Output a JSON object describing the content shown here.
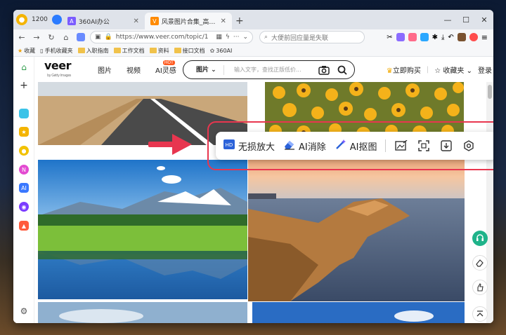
{
  "browser": {
    "points_value": "1200",
    "tabs": [
      {
        "title": "360AI办公",
        "active": false
      },
      {
        "title": "风景图片合集_高清风景图片免费下载",
        "active": true
      }
    ],
    "window_controls": [
      "minimize",
      "maximize",
      "close"
    ],
    "url": "https://www.veer.com/topic/1",
    "search_placeholder": "大便前回应量是失联",
    "bookmarks": [
      {
        "label": "收藏",
        "icon": "star-icon"
      },
      {
        "label": "手机收藏夹",
        "icon": "phone-icon"
      },
      {
        "label": "入职指南",
        "icon": "folder-icon"
      },
      {
        "label": "工作文档",
        "icon": "folder-icon"
      },
      {
        "label": "资料",
        "icon": "folder-icon"
      },
      {
        "label": "接口文档",
        "icon": "folder-icon"
      },
      {
        "label": "360AI",
        "icon": "sparkle-icon"
      }
    ]
  },
  "site": {
    "logo": "veer",
    "logo_sub": "by Getty Images",
    "nav": [
      {
        "label": "图片",
        "badge": ""
      },
      {
        "label": "视频",
        "badge": ""
      },
      {
        "label": "AI灵感",
        "badge": "HOT"
      }
    ],
    "search": {
      "category": "图片",
      "placeholder": "输入文字，查找正版低价..."
    },
    "buy_label": "立即购买",
    "favorites_label": "收藏夹",
    "login_label": "登录"
  },
  "toolbar": {
    "items": [
      {
        "label": "无损放大",
        "icon": "hd-upscale-icon"
      },
      {
        "label": "AI消除",
        "icon": "eraser-icon"
      },
      {
        "label": "AI抠图",
        "icon": "magic-wand-icon"
      }
    ],
    "icon_buttons": [
      "edit-image-icon",
      "crop-icon",
      "download-icon",
      "settings-hex-icon"
    ]
  },
  "colors": {
    "annotation_red": "#e8364f",
    "accent_blue": "#2b7bff",
    "hot_badge": "#ff5a1f"
  }
}
